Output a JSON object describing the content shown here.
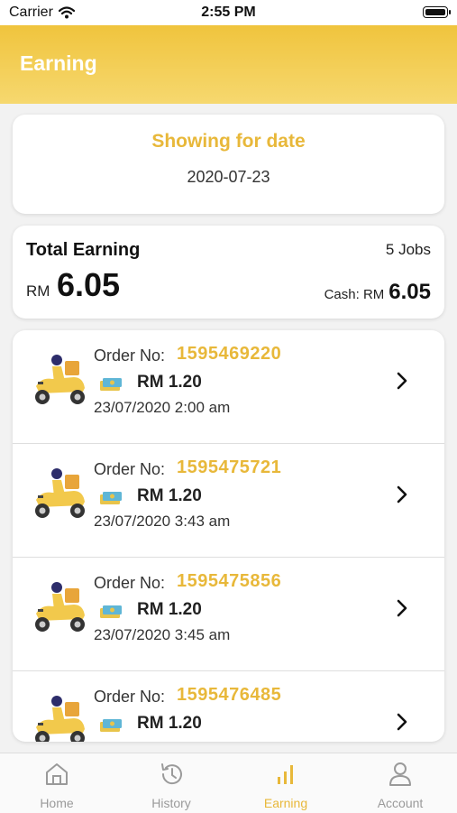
{
  "status_bar": {
    "carrier": "Carrier",
    "time": "2:55 PM"
  },
  "header": {
    "title": "Earning"
  },
  "date_card": {
    "title": "Showing for date",
    "date": "2020-07-23"
  },
  "summary": {
    "label": "Total Earning",
    "jobs": "5 Jobs",
    "currency": "RM",
    "total": "6.05",
    "cash_label": "Cash: RM",
    "cash_amount": "6.05"
  },
  "orders": [
    {
      "label": "Order No:",
      "number": "1595469220",
      "amount": "RM 1.20",
      "datetime": "23/07/2020 2:00 am"
    },
    {
      "label": "Order No:",
      "number": "1595475721",
      "amount": "RM 1.20",
      "datetime": "23/07/2020 3:43 am"
    },
    {
      "label": "Order No:",
      "number": "1595475856",
      "amount": "RM 1.20",
      "datetime": "23/07/2020 3:45 am"
    },
    {
      "label": "Order No:",
      "number": "1595476485",
      "amount": "RM 1.20",
      "datetime": ""
    }
  ],
  "tabs": [
    {
      "label": "Home",
      "icon": "home-icon"
    },
    {
      "label": "History",
      "icon": "history-icon"
    },
    {
      "label": "Earning",
      "icon": "bar-chart-icon",
      "active": true
    },
    {
      "label": "Account",
      "icon": "user-icon"
    }
  ],
  "colors": {
    "accent": "#e8b83a",
    "header": "#f2c94c",
    "inactive": "#9a9a9a"
  }
}
